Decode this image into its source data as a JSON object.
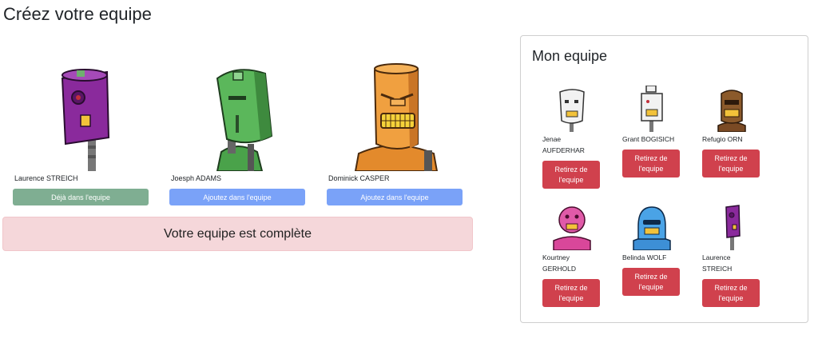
{
  "page": {
    "title": "Créez votre equipe"
  },
  "candidates": [
    {
      "name": "Laurence STREICH",
      "button": "Déjà dans l'equipe",
      "robot": "purple-tall-robot"
    },
    {
      "name": "Joesph ADAMS",
      "button": "Ajoutez dans l'equipe",
      "robot": "green-robot"
    },
    {
      "name": "Dominick CASPER",
      "button": "Ajoutez dans l'equipe",
      "robot": "orange-robot"
    }
  ],
  "alert": {
    "text": "Votre equipe est complète"
  },
  "team": {
    "title": "Mon equipe",
    "remove_label": "Retirez de l'equipe",
    "members": [
      {
        "name": "Jenae AUFDERHAR",
        "robot": "white-robot"
      },
      {
        "name": "Grant BOGISICH",
        "robot": "white-bottle-robot"
      },
      {
        "name": "Refugio ORN",
        "robot": "brown-robot"
      },
      {
        "name": "Kourtney GERHOLD",
        "robot": "pink-robot"
      },
      {
        "name": "Belinda WOLF",
        "robot": "blue-robot"
      },
      {
        "name": "Laurence STREICH",
        "robot": "purple-tall-robot"
      }
    ]
  },
  "colors": {
    "done": "#7fae92",
    "add": "#7aa2f8",
    "remove": "#d0414d",
    "alert_bg": "#f5d7da"
  }
}
